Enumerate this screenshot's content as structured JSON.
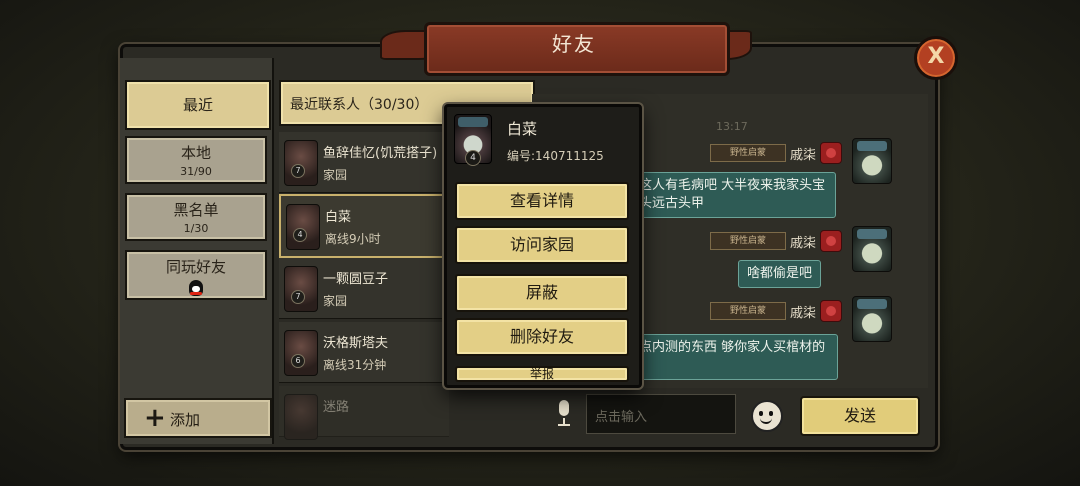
{
  "title": "好友",
  "close_symbol": "X",
  "tabs": [
    {
      "label": "最近",
      "sub": ""
    },
    {
      "label": "本地",
      "sub": "31/90"
    },
    {
      "label": "黑名单",
      "sub": "1/30"
    },
    {
      "label": "同玩好友",
      "sub": ""
    }
  ],
  "add_label": "添加",
  "list_header": "最近联系人（30/30）",
  "contacts": [
    {
      "name": "鱼辞佳忆(饥荒搭子)",
      "status": "家园",
      "level": "7"
    },
    {
      "name": "白菜",
      "status": "离线9小时",
      "level": "4"
    },
    {
      "name": "一颗圆豆子",
      "status": "家园",
      "level": "7"
    },
    {
      "name": "沃格斯塔夫",
      "status": "离线31分钟",
      "level": "6"
    },
    {
      "name": "迷路",
      "status": "",
      "level": ""
    }
  ],
  "chat": {
    "time": "13:17",
    "messages": [
      {
        "tag": "野性启蒙",
        "user": "戚柒",
        "text": "这人有毛病吧 大半夜来我家头宝头远古头甲"
      },
      {
        "tag": "野性启蒙",
        "user": "戚柒",
        "text": "啥都偷是吧"
      },
      {
        "tag": "野性启蒙",
        "user": "戚柒",
        "text": "点内测的东西 够你家人买棺材的"
      }
    ]
  },
  "input_placeholder": "点击输入",
  "send_label": "发送",
  "popup": {
    "name": "白菜",
    "id": "编号:140711125",
    "level": "4",
    "buttons": [
      "查看详情",
      "访问家园",
      "屏蔽",
      "删除好友"
    ],
    "cut_button": "举报"
  }
}
